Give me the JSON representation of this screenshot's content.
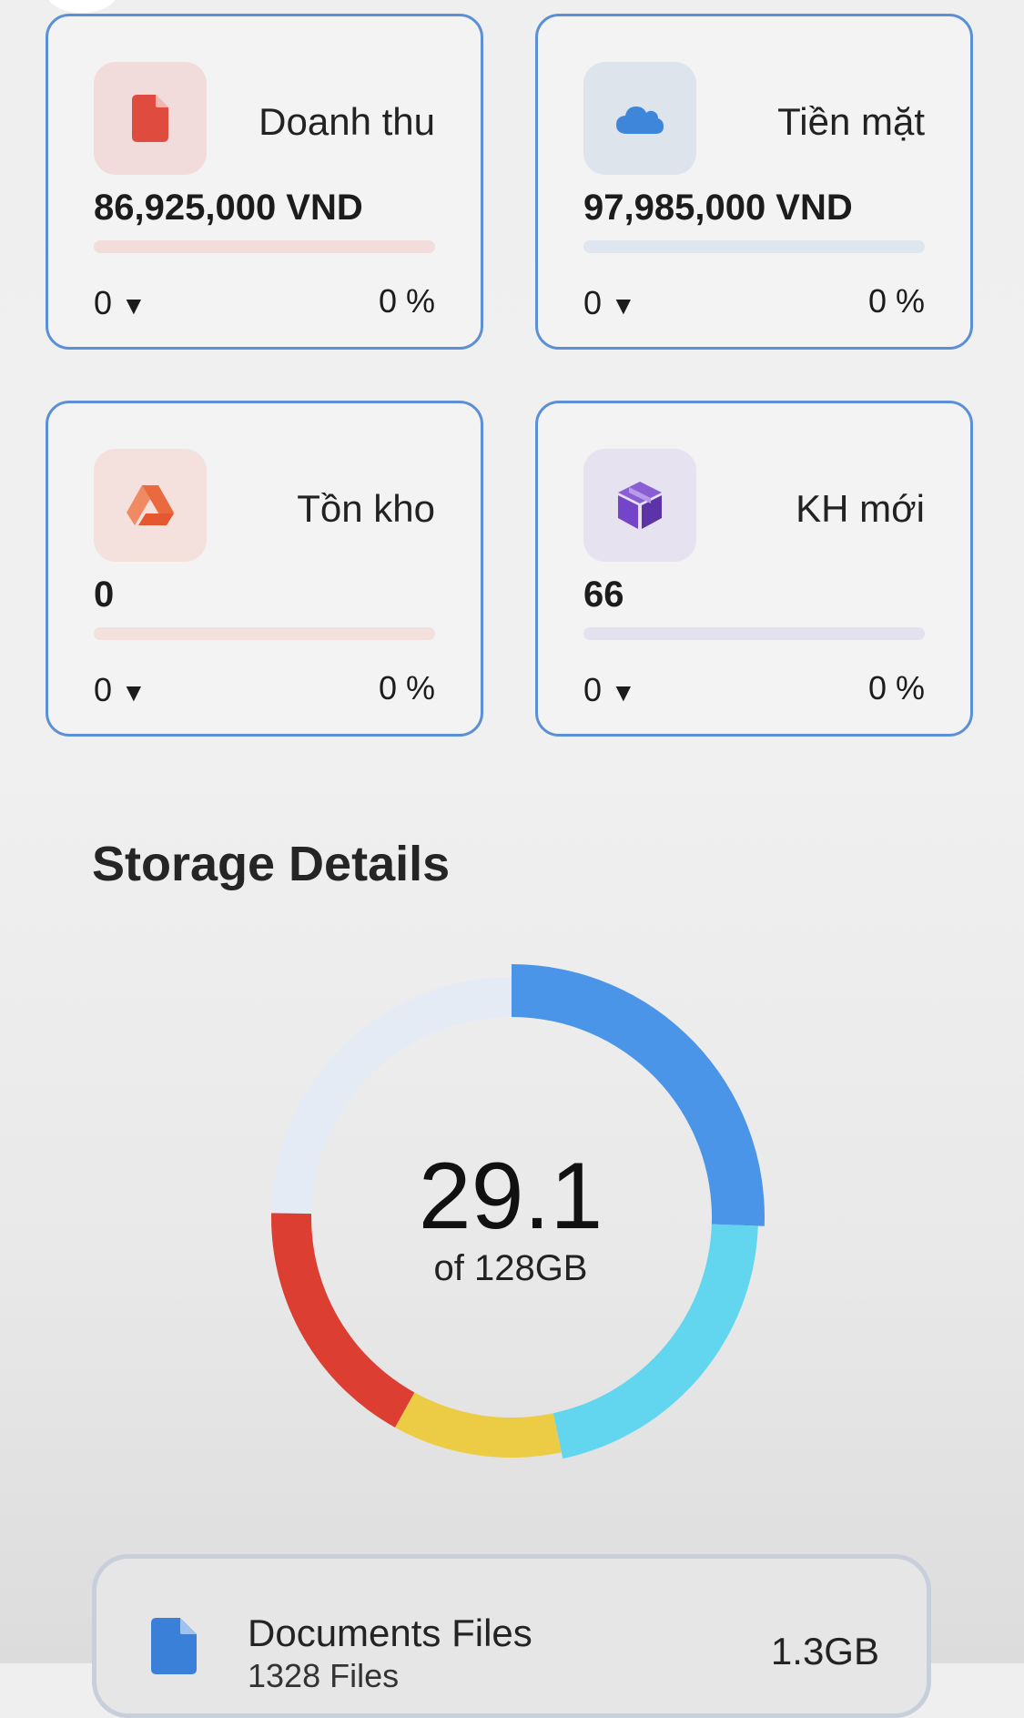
{
  "stat_cards": [
    {
      "title": "Doanh thu",
      "value": "86,925,000 VND",
      "change": "0",
      "change_arrow": "▼",
      "percent": "0 %",
      "icon": "file-icon",
      "progress": 0,
      "icon_color": "#e04b3f",
      "tint_color": "#f2dcdb",
      "bar_color": "#f3dcdc"
    },
    {
      "title": "Tiền mặt",
      "value": "97,985,000 VND",
      "change": "0",
      "change_arrow": "▼",
      "percent": "0 %",
      "icon": "cloud-icon",
      "progress": 0,
      "icon_color": "#3d86d9",
      "tint_color": "#dde4ec",
      "bar_color": "#dfe6ef"
    },
    {
      "title": "Tồn kho",
      "value": "0",
      "change": "0",
      "change_arrow": "▼",
      "percent": "0 %",
      "icon": "google-drive-icon",
      "progress": 0,
      "icon_color": "#ea6a3f",
      "tint_color": "#f4e0dc",
      "bar_color": "#f4e1dd"
    },
    {
      "title": "KH mới",
      "value": "66",
      "change": "0",
      "change_arrow": "▼",
      "percent": "0 %",
      "icon": "box-icon",
      "progress": 0,
      "icon_color": "#7444c9",
      "tint_color": "#e6e2ef",
      "bar_color": "#e4e2ee"
    }
  ],
  "storage": {
    "title": "Storage Details",
    "used_value": "29.1",
    "used_caption": "of 128GB",
    "track_color": "#e4ebf4"
  },
  "chart_data": {
    "type": "donut",
    "title": "Storage Details",
    "center_value": "29.1",
    "center_label": "of 128GB",
    "segments": [
      {
        "color": "#4a95e8",
        "start_deg": 0,
        "end_deg": 92
      },
      {
        "color": "#62d6ef",
        "start_deg": 92,
        "end_deg": 168
      },
      {
        "color": "#eccb45",
        "start_deg": 168,
        "end_deg": 209
      },
      {
        "color": "#dc3e32",
        "start_deg": 209,
        "end_deg": 271
      }
    ]
  },
  "files": [
    {
      "name": "Documents Files",
      "count": "1328 Files",
      "size": "1.3GB",
      "icon": "document-icon",
      "icon_color": "#3a7fd8"
    }
  ]
}
